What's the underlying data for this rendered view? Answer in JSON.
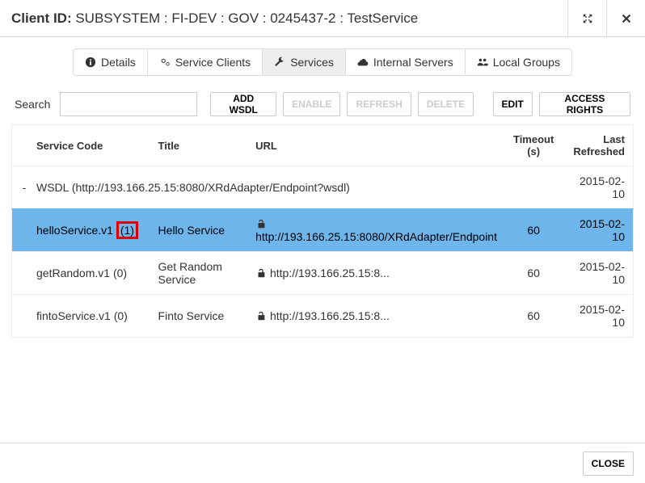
{
  "header": {
    "label": "Client ID:",
    "value": "SUBSYSTEM : FI-DEV : GOV : 0245437-2 : TestService"
  },
  "tabs": [
    {
      "label": "Details"
    },
    {
      "label": "Service Clients"
    },
    {
      "label": "Services"
    },
    {
      "label": "Internal Servers"
    },
    {
      "label": "Local Groups"
    }
  ],
  "toolbar": {
    "search_label": "Search",
    "add_wsdl": "ADD WSDL",
    "enable": "ENABLE",
    "refresh": "REFRESH",
    "delete": "DELETE",
    "edit": "EDIT",
    "access_rights": "ACCESS RIGHTS"
  },
  "table": {
    "headers": {
      "code": "Service Code",
      "title": "Title",
      "url": "URL",
      "timeout": "Timeout (s)",
      "refreshed": "Last Refreshed"
    },
    "wsdl": {
      "expand": "-",
      "label": "WSDL (http://193.166.25.15:8080/XRdAdapter/Endpoint?wsdl)",
      "refreshed": "2015-02-10"
    },
    "rows": [
      {
        "code": "helloService.v1",
        "code_suffix": "(1)",
        "title": "Hello Service",
        "url": "http://193.166.25.15:8080/XRdAdapter/Endpoint",
        "timeout": "60",
        "refreshed": "2015-02-10",
        "selected": true,
        "highlight_suffix": true
      },
      {
        "code": "getRandom.v1 (0)",
        "title": "Get Random Service",
        "url": "http://193.166.25.15:8...",
        "timeout": "60",
        "refreshed": "2015-02-10"
      },
      {
        "code": "fintoService.v1 (0)",
        "title": "Finto Service",
        "url": "http://193.166.25.15:8...",
        "timeout": "60",
        "refreshed": "2015-02-10"
      }
    ]
  },
  "footer": {
    "close": "CLOSE"
  }
}
